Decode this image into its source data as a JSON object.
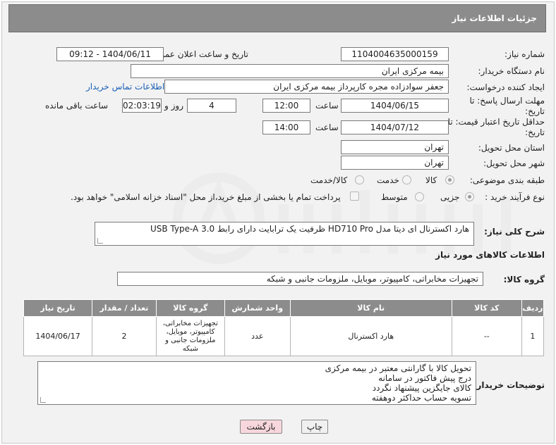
{
  "header": {
    "title": "جزئیات اطلاعات نیاز"
  },
  "labels": {
    "need_number": "شماره نیاز:",
    "announce_datetime": "تاریخ و ساعت اعلان عمومی:",
    "buyer_org": "نام دستگاه خریدار:",
    "requester": "ایجاد کننده درخواست:",
    "reply_deadline": "مهلت ارسال پاسخ: تا تاریخ:",
    "price_validity": "حداقل تاریخ اعتبار قیمت: تا تاریخ:",
    "time": "ساعت",
    "day_and": "روز و",
    "hours_left": "ساعت باقی مانده",
    "delivery_province": "استان محل تحویل:",
    "delivery_city": "شهر محل تحویل:",
    "subject_category": "طبقه بندی موضوعی:",
    "purchase_type": "نوع فرآیند خرید :",
    "general_description": "شرح کلی نیاز:",
    "goods_info": "اطلاعات کالاهای مورد نیاز",
    "goods_group": "گروه کالا:",
    "buyer_notes": "توضیحات خریدار:"
  },
  "values": {
    "need_number": "1104004635000159",
    "announce_datetime": "1404/06/11 - 09:12",
    "buyer_org": "بیمه مرکزی ایران",
    "requester": "جعفر سوادزاده مجره کارپرداز بیمه مرکزی ایران",
    "contact_link": "اطلاعات تماس خریدار",
    "reply_date": "1404/06/15",
    "reply_time": "12:00",
    "days": "4",
    "remaining": "02:03:19",
    "validity_date": "1404/07/12",
    "validity_time": "14:00",
    "province": "تهران",
    "city": "تهران",
    "general_description": "هارد اکسترنال ای دیتا مدل HD710 Pro ظرفیت یک ترابایت دارای رابط USB Type-A 3.0",
    "goods_group": "تجهیزات مخابراتی، کامپیوتر، موبایل، ملزومات جانبی و شبکه"
  },
  "subject_options": [
    {
      "label": "کالا",
      "checked": true
    },
    {
      "label": "خدمت",
      "checked": false
    },
    {
      "label": "کالا/خدمت",
      "checked": false
    }
  ],
  "purchase_options": [
    {
      "label": "جزیی",
      "checked": true
    },
    {
      "label": "متوسط",
      "checked": false
    }
  ],
  "treasury_note": "پرداخت تمام یا بخشی از مبلغ خرید،از محل \"اسناد خزانه اسلامی\" خواهد بود.",
  "table": {
    "headers": [
      "ردیف",
      "کد کالا",
      "نام کالا",
      "واحد شمارش",
      "گروه کالا",
      "تعداد / مقدار",
      "تاریخ نیاز"
    ],
    "rows": [
      [
        "1",
        "--",
        "هارد اکسترنال",
        "عدد",
        "تجهیزات مخابراتی، کامپیوتر، موبایل، ملزومات جانبی و شبکه",
        "2",
        "1404/06/17"
      ]
    ]
  },
  "buyer_notes": [
    "تحویل کالا با گارانتی معتبر در بیمه مرکزی",
    "درج پیش فاکتور در سامانه",
    "کالای جایگزین پیشنهاد نگردد",
    "تسویه حساب حداکثر دوهفته"
  ],
  "buttons": {
    "print": "چاپ",
    "back": "بازگشت"
  },
  "colors": {
    "header_bg": "#8c8c8c",
    "link": "#1a5fb4",
    "back_button": "#f8d7dc"
  }
}
